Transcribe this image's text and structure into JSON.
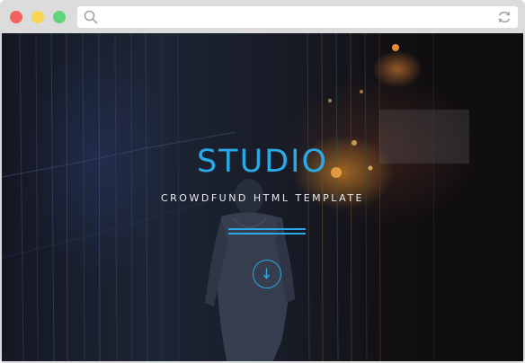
{
  "browser": {
    "buttons": {
      "close": {
        "color": "#f2655e",
        "icon": "close-dot"
      },
      "minimize": {
        "color": "#f7d552",
        "icon": "minimize-dot"
      },
      "maximize": {
        "color": "#5fd47c",
        "icon": "maximize-dot"
      }
    },
    "address_bar": {
      "value": "",
      "left_icon": "search-icon",
      "right_icon": "reload-icon"
    }
  },
  "hero": {
    "title": "STUDIO",
    "subtitle": "CROWDFUND HTML TEMPLATE",
    "scroll_icon": "arrow-down-icon",
    "accent_color": "#2aa9e6"
  }
}
